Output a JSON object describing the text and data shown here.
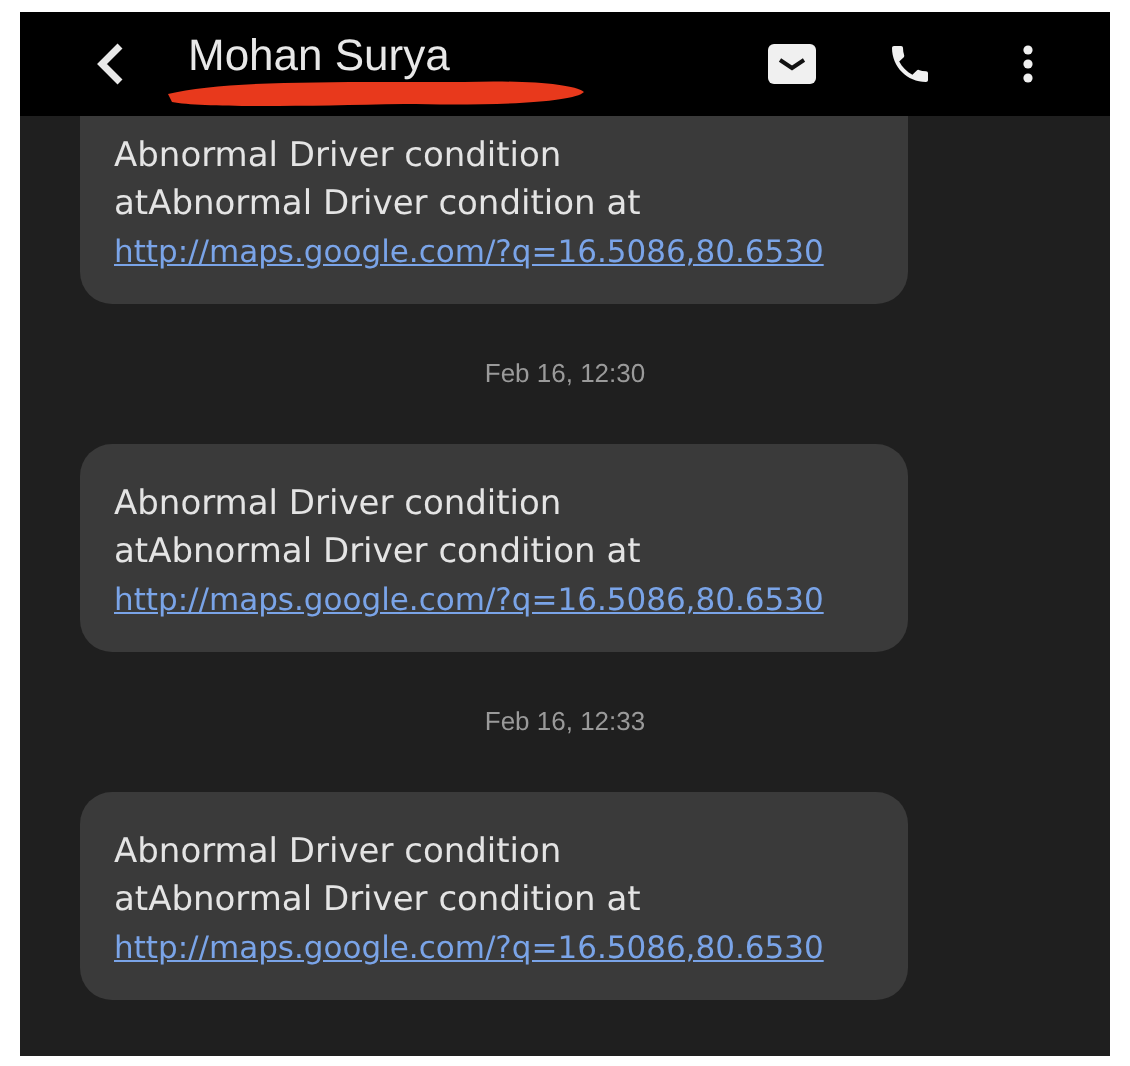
{
  "header": {
    "contact_name": "Mohan Surya"
  },
  "conversation": [
    {
      "kind": "message",
      "text": "Abnormal Driver condition atAbnormal Driver condition at",
      "link": "http://maps.google.com/?q=16.5086,80.6530",
      "cut_top": true
    },
    {
      "kind": "timestamp",
      "text": "Feb 16, 12:30"
    },
    {
      "kind": "message",
      "text": "Abnormal Driver condition atAbnormal Driver condition at",
      "link": "http://maps.google.com/?q=16.5086,80.6530",
      "cut_top": false
    },
    {
      "kind": "timestamp",
      "text": "Feb 16, 12:33"
    },
    {
      "kind": "message",
      "text": "Abnormal Driver condition atAbnormal Driver condition at",
      "link": "http://maps.google.com/?q=16.5086,80.6530",
      "cut_top": false
    }
  ]
}
